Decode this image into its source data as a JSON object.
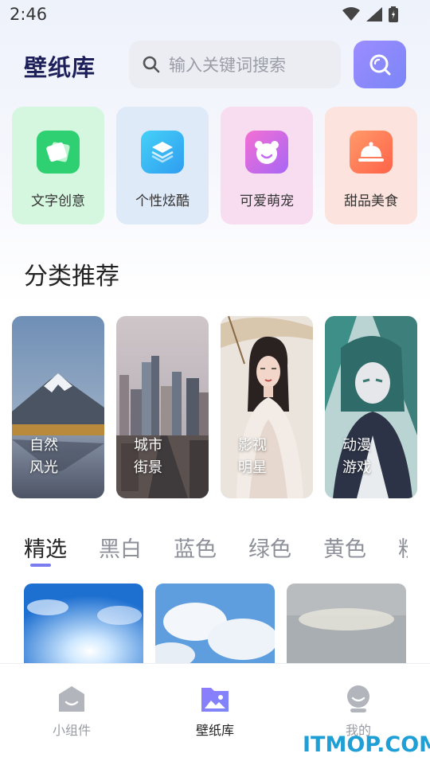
{
  "status": {
    "time": "2:46"
  },
  "header": {
    "logo": "壁纸库",
    "search_placeholder": "输入关键词搜索"
  },
  "quick_actions": [
    {
      "label": "文字创意",
      "icon": "text-card-icon",
      "bg": "#d6f7df",
      "icon_color": "#2fd071"
    },
    {
      "label": "个性炫酷",
      "icon": "layers-icon",
      "bg": "#dfeaf8",
      "icon_color": "#33b4f0"
    },
    {
      "label": "可爱萌宠",
      "icon": "bear-icon",
      "bg": "#f8ddf1",
      "icon_color": "#b368f4"
    },
    {
      "label": "甜品美食",
      "icon": "food-cover-icon",
      "bg": "#fde3de",
      "icon_color": "#ff7a55"
    }
  ],
  "categories": {
    "title": "分类推荐",
    "items": [
      {
        "label": "自然\n风光"
      },
      {
        "label": "城市\n街景"
      },
      {
        "label": "影视\n明星"
      },
      {
        "label": "动漫\n游戏"
      }
    ]
  },
  "color_tabs": [
    "精选",
    "黑白",
    "蓝色",
    "绿色",
    "黄色",
    "粉"
  ],
  "active_tab": "精选",
  "bottom_nav": [
    {
      "label": "小组件",
      "icon": "widget-icon",
      "active": false
    },
    {
      "label": "壁纸库",
      "icon": "wallpaper-icon",
      "active": true
    },
    {
      "label": "我的",
      "icon": "profile-icon",
      "active": false
    }
  ],
  "watermark": "ITMOP.COM",
  "colors": {
    "accent": "#7b7cf0",
    "logo": "#1d1f5a"
  }
}
